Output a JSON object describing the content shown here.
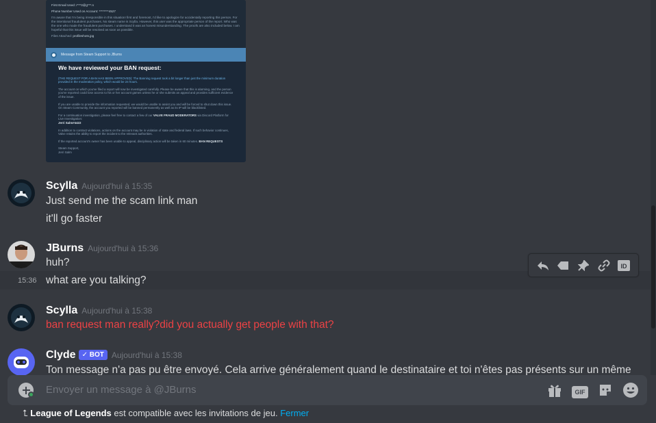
{
  "attachment": {
    "top_lines": [
      "First Email Used: r***3@g***.n",
      "Phone Number Used on Account: ********4527"
    ],
    "top_paragraph": "I'm aware that I'm being irresponsible in this situation! first and foremost, I'd like to apologize for accidentally reporting this person. For the intentional fraudulent purchases. No steam name is Scylla. However, this user was the appropriate person of the report. Who was the one who made the fraudulent purchases. I understand it was an honest misunderstanding. The proofs are also included below. I am hopeful that this issue will be resolved as soon as possible.",
    "files_attached_label": "Files Attached:",
    "files_attached_value": "profileshots.jpg",
    "header_bar": "Message from Steam Support to JBurns",
    "heading": "We have reviewed your BAN request:",
    "p1": "(THE REQUEST FOR A BAN HAS BEEN APPROVED): The Banning request took a bit longer than just the minimum duration provided in the moderation policy, which would be 24 hours.",
    "p2": "The account on which you've filed a report will now be investigated carefully. Please be aware that this is alarming, and the person you've reported could lose access to his or her account games unless he or she submits an appeal and provides sufficient evidence of the issue.",
    "p3": "If you are unable to provide the information requested, we would be unable to assist you and will be forced to shut down this issue. On Steam Community, the account you reported will be banned permanently as well as its IP will be blacklisted.",
    "p4a": "For a continuation investigation, please feel free to contact a few of our",
    "p4b": "VALVE FRAUD MODERATORS",
    "p4c": "via Discord Platform for Live Investigation:",
    "p4d": "Jerri Salm#4422",
    "p5": "In addition to contract violations, actions on the account may be in violation of state and federal laws. If such behavior continues, Valve retains the ability to report the incident to the relevant authorities.",
    "p6a": "If the reported account's owner has been unable to appeal, disciplinary action will be taken in 60 minutes.",
    "p6b": "BAN REQUESTS",
    "sign1": "Steam Support,",
    "sign2": "Jerri Salm"
  },
  "messages": [
    {
      "author": "Scylla",
      "timestamp": "Aujourd'hui à 15:35",
      "lines": [
        "Just send me the scam link man",
        "it'll go faster"
      ]
    },
    {
      "author": "JBurns",
      "timestamp": "Aujourd'hui à 15:36",
      "lines": [
        "huh?",
        "what are you talking?"
      ],
      "hover_time": "15:36"
    },
    {
      "author": "Scylla",
      "timestamp": "Aujourd'hui à 15:38",
      "lines": [
        "ban request man really?did you actually get people with that?"
      ]
    },
    {
      "author": "Clyde",
      "badge": "BOT",
      "timestamp": "Aujourd'hui à 15:38",
      "lines": [
        "Ton message n'a pas pu être envoyé. Cela arrive généralement quand le destinataire et toi n'êtes pas présents sur un même"
      ]
    }
  ],
  "toolbar": {
    "icons": [
      "reply-icon",
      "label-icon",
      "pin-icon",
      "link-icon",
      "id-icon"
    ],
    "id_label": "ID"
  },
  "input": {
    "placeholder": "Envoyer un message à @JBurns",
    "gif_label": "GIF"
  },
  "activity": {
    "game": "League of Legends",
    "text": "est compatible avec les invitations de jeu.",
    "close": "Fermer"
  },
  "colors": {
    "background": "#36393f",
    "input": "#40444b",
    "accent_blurple": "#5865f2",
    "error_red": "#ed4245",
    "link": "#00aff4"
  }
}
